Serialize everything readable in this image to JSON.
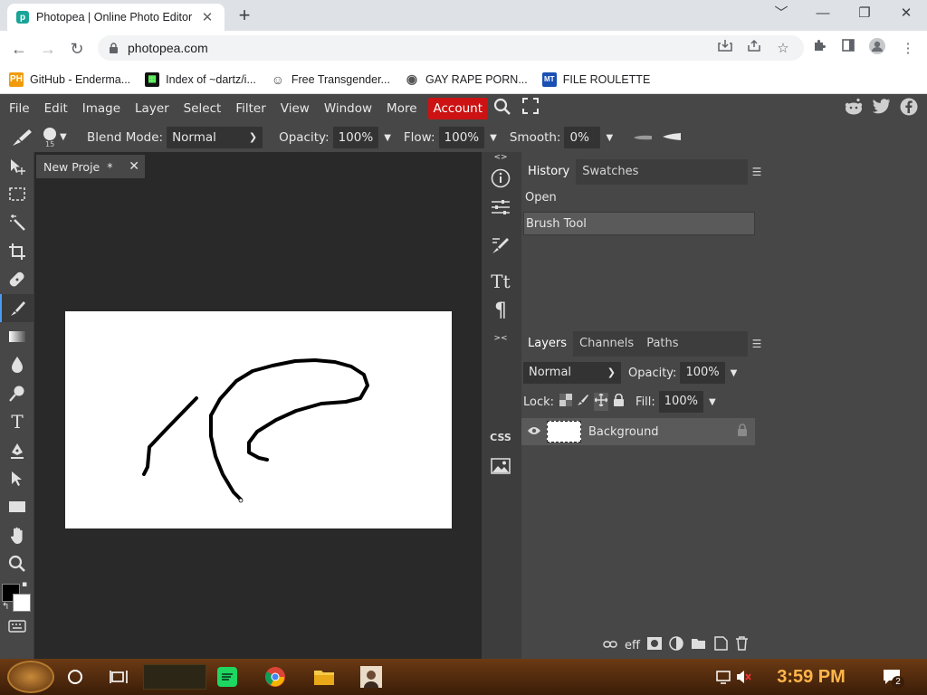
{
  "browser": {
    "tab_title": "Photopea | Online Photo Editor",
    "tab_close": "✕",
    "new_tab": "+",
    "url": "photopea.com",
    "window_controls": [
      "﹀",
      "—",
      "❐",
      "✕"
    ]
  },
  "bookmarks": [
    {
      "label": "GitHub - Enderma...",
      "icon": "PH",
      "icon_bg": "#f19b0c"
    },
    {
      "label": "Index of ~dartz/i...",
      "icon": "▦",
      "icon_bg": "#111111"
    },
    {
      "label": "Free Transgender...",
      "icon": "☺",
      "icon_bg": "#ffffff"
    },
    {
      "label": "GAY RAPE PORN...",
      "icon": "◉",
      "icon_bg": "#ffffff"
    },
    {
      "label": "FILE ROULETTE",
      "icon": "MT",
      "icon_bg": "#1a4fb3"
    }
  ],
  "menu": {
    "items": [
      "File",
      "Edit",
      "Image",
      "Layer",
      "Select",
      "Filter",
      "View",
      "Window",
      "More"
    ],
    "account": "Account",
    "accent_color": "#cc1212"
  },
  "options": {
    "brush_size": "15",
    "blend_label": "Blend Mode:",
    "blend_value": "Normal",
    "opacity_label": "Opacity:",
    "opacity_value": "100%",
    "flow_label": "Flow:",
    "flow_value": "100%",
    "smooth_label": "Smooth:",
    "smooth_value": "0%"
  },
  "document": {
    "tab_title": "New Proje",
    "modified": "*",
    "close": "✕"
  },
  "history": {
    "tabs": [
      "History",
      "Swatches"
    ],
    "items": [
      "Open",
      "Brush Tool"
    ],
    "selected_index": 1
  },
  "layers": {
    "tabs": [
      "Layers",
      "Channels",
      "Paths"
    ],
    "blend_value": "Normal",
    "opacity_label": "Opacity:",
    "opacity_value": "100%",
    "lock_label": "Lock:",
    "fill_label": "Fill:",
    "fill_value": "100%",
    "layer_name": "Background",
    "footer_eff": "eff"
  },
  "icon_column": {
    "expander": "<>",
    "collapse": "><",
    "css_label": "CSS",
    "text_label": "Tt",
    "para_label": "¶"
  },
  "taskbar": {
    "time": "3:59 PM",
    "notifications": "2"
  }
}
